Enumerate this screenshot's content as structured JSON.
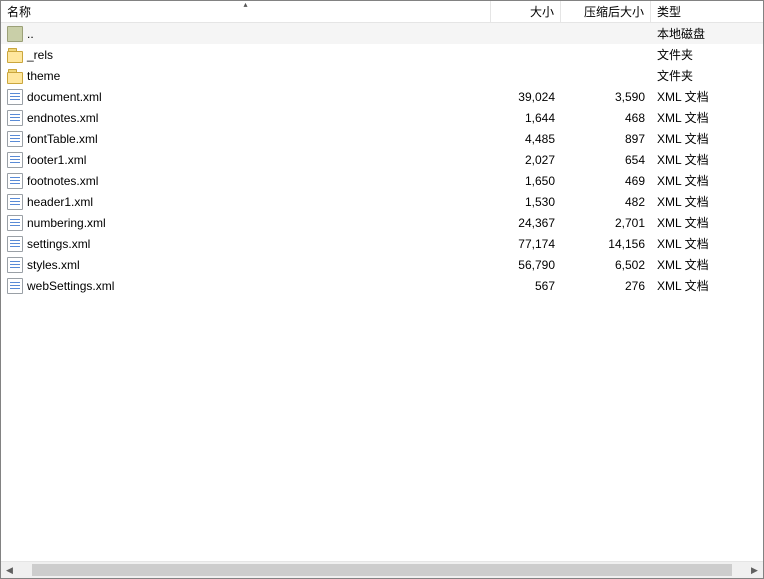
{
  "columns": {
    "name": "名称",
    "size": "大小",
    "csize": "压缩后大小",
    "type": "类型"
  },
  "sort_indicator": "▴",
  "rows": [
    {
      "icon": "disk",
      "name": "..",
      "size": "",
      "csize": "",
      "type": "本地磁盘",
      "selected": true
    },
    {
      "icon": "folder",
      "name": "_rels",
      "size": "",
      "csize": "",
      "type": "文件夹"
    },
    {
      "icon": "folder",
      "name": "theme",
      "size": "",
      "csize": "",
      "type": "文件夹"
    },
    {
      "icon": "xml",
      "name": "document.xml",
      "size": "39,024",
      "csize": "3,590",
      "type": "XML 文档"
    },
    {
      "icon": "xml",
      "name": "endnotes.xml",
      "size": "1,644",
      "csize": "468",
      "type": "XML 文档"
    },
    {
      "icon": "xml",
      "name": "fontTable.xml",
      "size": "4,485",
      "csize": "897",
      "type": "XML 文档"
    },
    {
      "icon": "xml",
      "name": "footer1.xml",
      "size": "2,027",
      "csize": "654",
      "type": "XML 文档"
    },
    {
      "icon": "xml",
      "name": "footnotes.xml",
      "size": "1,650",
      "csize": "469",
      "type": "XML 文档"
    },
    {
      "icon": "xml",
      "name": "header1.xml",
      "size": "1,530",
      "csize": "482",
      "type": "XML 文档"
    },
    {
      "icon": "xml",
      "name": "numbering.xml",
      "size": "24,367",
      "csize": "2,701",
      "type": "XML 文档"
    },
    {
      "icon": "xml",
      "name": "settings.xml",
      "size": "77,174",
      "csize": "14,156",
      "type": "XML 文档"
    },
    {
      "icon": "xml",
      "name": "styles.xml",
      "size": "56,790",
      "csize": "6,502",
      "type": "XML 文档"
    },
    {
      "icon": "xml",
      "name": "webSettings.xml",
      "size": "567",
      "csize": "276",
      "type": "XML 文档"
    }
  ],
  "scrollbar": {
    "left_glyph": "◀",
    "right_glyph": "▶"
  }
}
